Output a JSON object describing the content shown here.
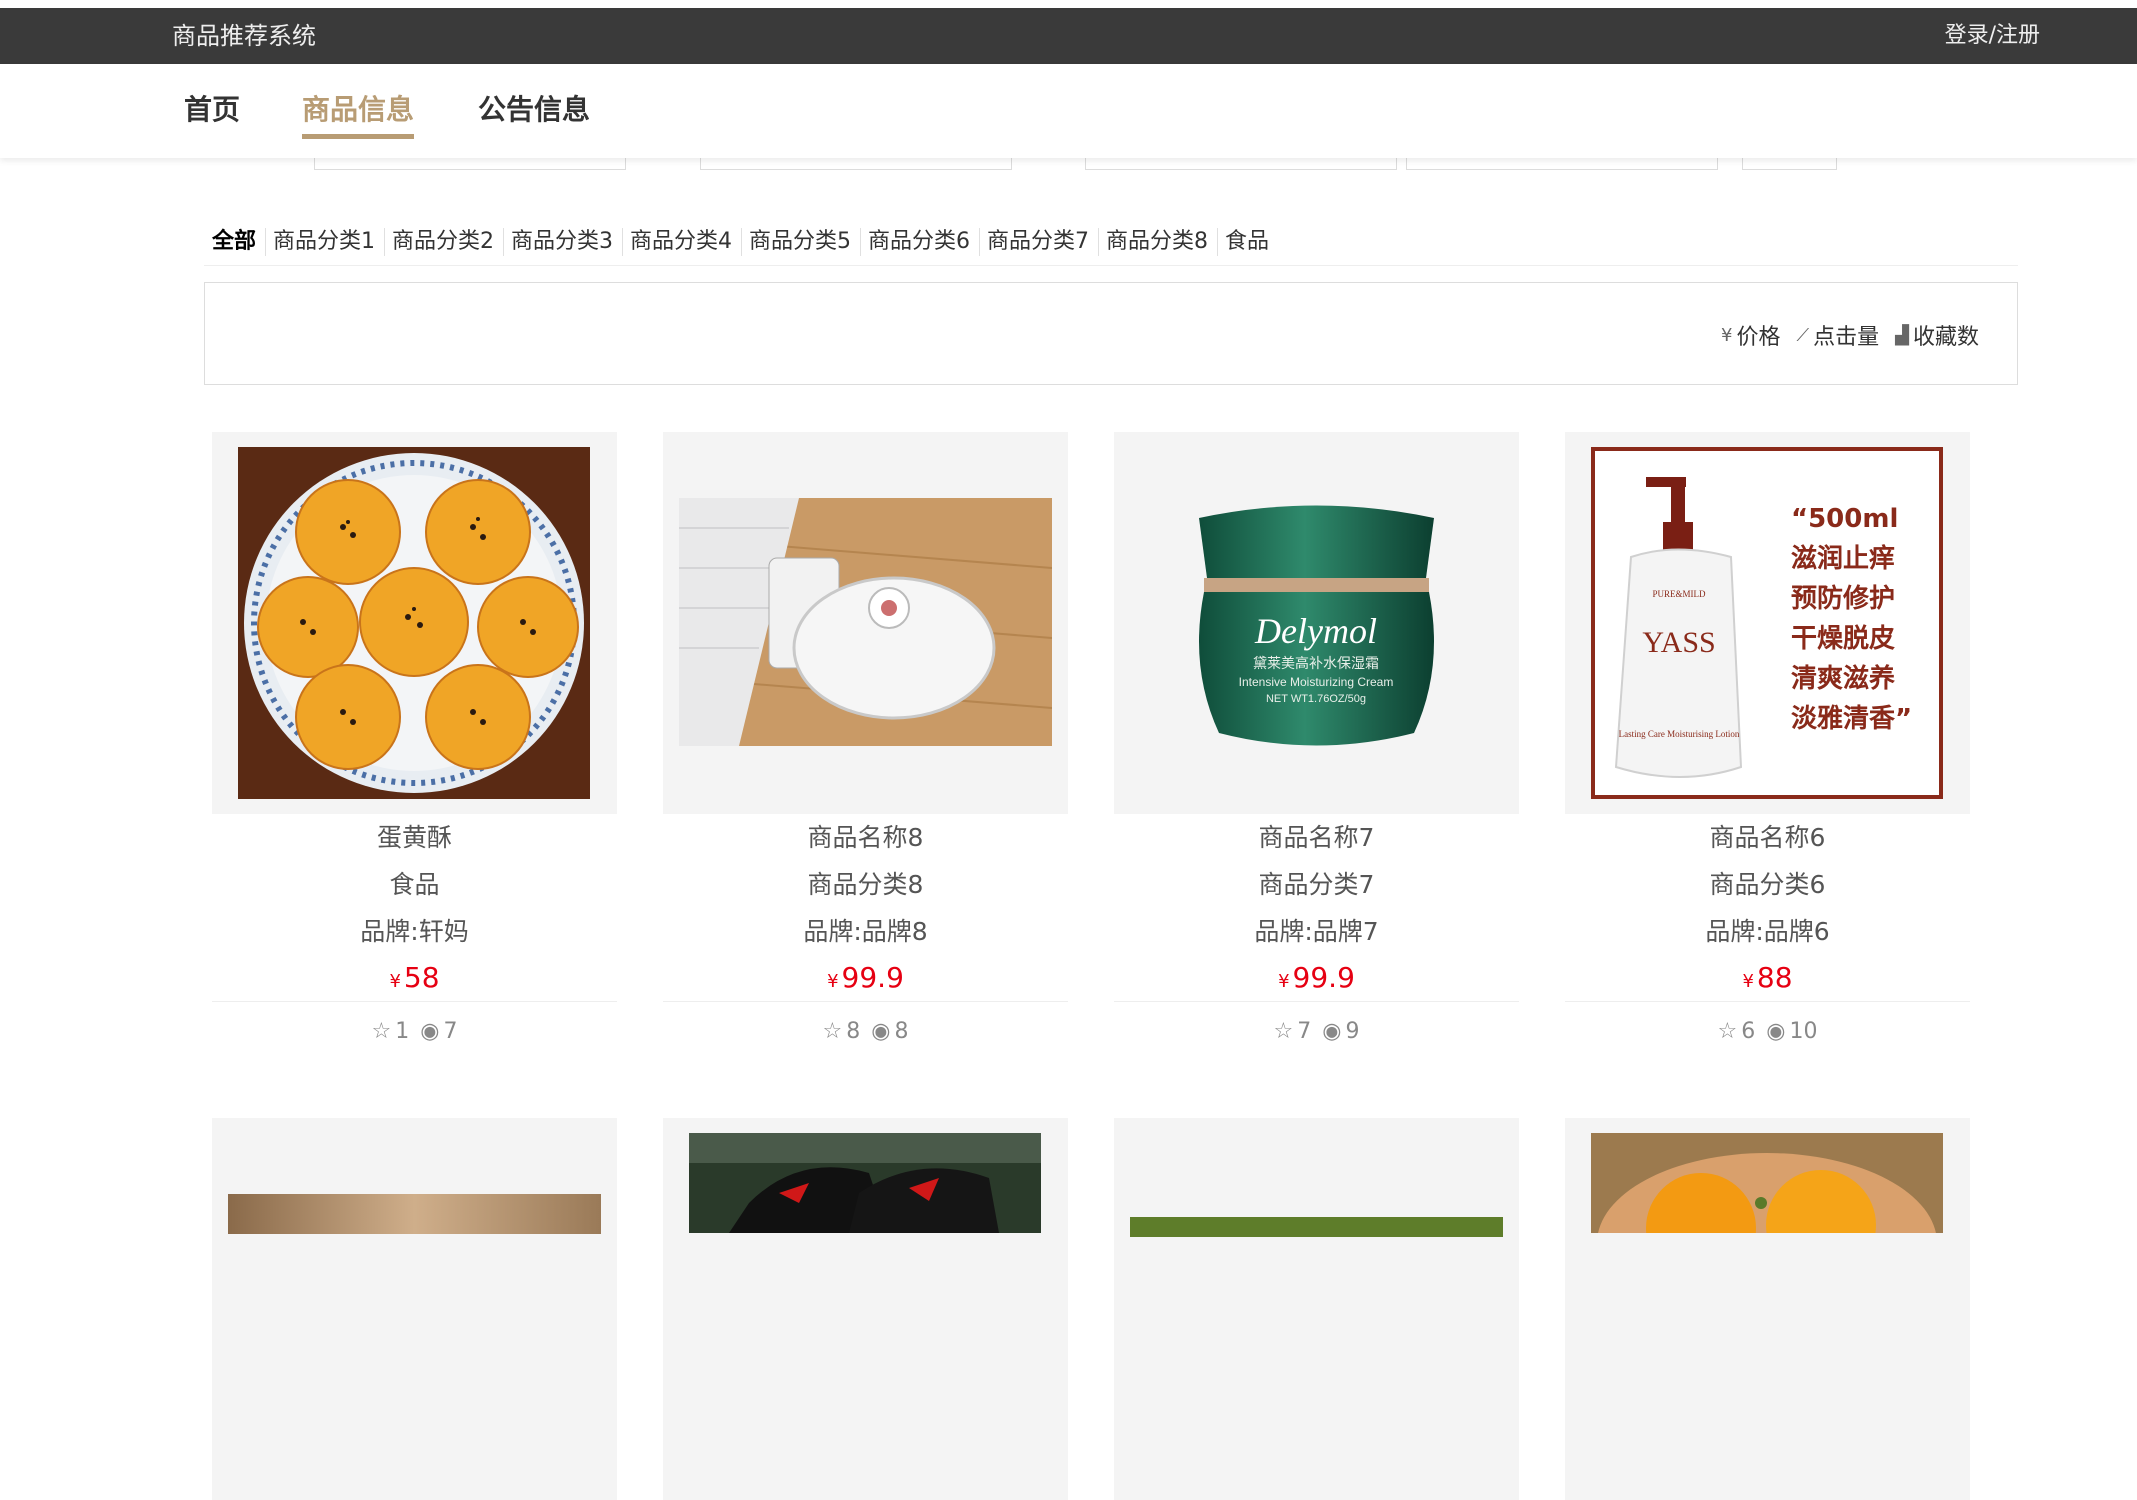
{
  "header": {
    "brand": "商品推荐系统",
    "login": "登录/注册"
  },
  "nav": [
    {
      "label": "首页",
      "active": false
    },
    {
      "label": "商品信息",
      "active": true
    },
    {
      "label": "公告信息",
      "active": false
    }
  ],
  "categories": [
    "全部",
    "商品分类1",
    "商品分类2",
    "商品分类3",
    "商品分类4",
    "商品分类5",
    "商品分类6",
    "商品分类7",
    "商品分类8",
    "食品"
  ],
  "sort": [
    {
      "icon": "yen-icon",
      "glyph": "¥",
      "label": "价格"
    },
    {
      "icon": "trend-icon",
      "glyph": "⟋",
      "label": "点击量"
    },
    {
      "icon": "bar-chart-icon",
      "glyph": "▟",
      "label": "收藏数"
    }
  ],
  "products": [
    {
      "name": "蛋黄酥",
      "category": "食品",
      "brand": "品牌:轩妈",
      "price": "58",
      "favorites": "1",
      "views": "7",
      "image": "egg-yolk-pastry"
    },
    {
      "name": "商品名称8",
      "category": "商品分类8",
      "brand": "品牌:品牌8",
      "price": "99.9",
      "favorites": "8",
      "views": "8",
      "image": "robot-vacuum"
    },
    {
      "name": "商品名称7",
      "category": "商品分类7",
      "brand": "品牌:品牌7",
      "price": "99.9",
      "favorites": "7",
      "views": "9",
      "image": "cream-jar"
    },
    {
      "name": "商品名称6",
      "category": "商品分类6",
      "brand": "品牌:品牌6",
      "price": "88",
      "favorites": "6",
      "views": "10",
      "image": "body-lotion"
    }
  ],
  "lotion": {
    "brand_mark": "YASS",
    "tag": "PURE&MILD",
    "bottle_text": "Lasting Care Moisturising Lotion",
    "lines": [
      "“500ml",
      "滋润止痒",
      "预防修护",
      "干燥脱皮",
      "清爽滋养",
      "淡雅清香”"
    ]
  },
  "cream": {
    "brand_mark": "Delymol",
    "line1": "黛莱美高补水保湿霜",
    "line2": "Intensive Moisturizing Cream",
    "line3": "NET WT1.76OZ/50g"
  },
  "colors": {
    "accent": "#b89c74",
    "price": "#e60012",
    "topbar": "#3a3a3a"
  },
  "currency": "¥"
}
